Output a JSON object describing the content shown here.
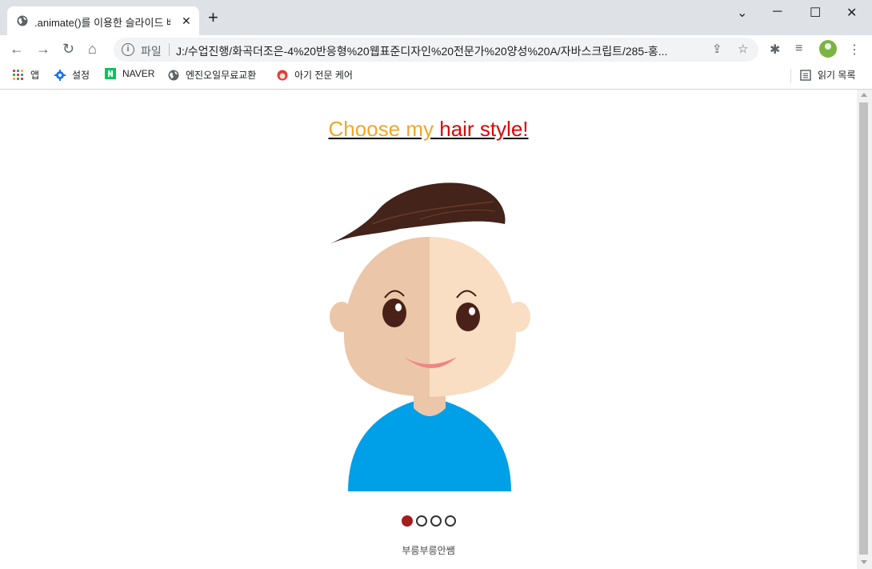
{
  "browser": {
    "tab_title": ".animate()를 이용한 슬라이드 배",
    "url_scheme": "파일",
    "url": "J:/수업진행/화곡더조은-4%20반응형%20웹표준디자인%20전문가%20양성%20A/자바스크립트/285-홍...",
    "bookmarks": [
      {
        "label": "앱",
        "icon": "apps-grid-icon"
      },
      {
        "label": "설정",
        "icon": "gear-icon"
      },
      {
        "label": "NAVER",
        "icon": "naver-icon"
      },
      {
        "label": "엔진오일무료교환",
        "icon": "globe-icon"
      },
      {
        "label": "아기 전문 케어",
        "icon": "baby-care-icon"
      }
    ],
    "reading_list_label": "읽기 목록"
  },
  "page": {
    "heading_part1": "Choose my ",
    "heading_part2": "hair style!",
    "slider": {
      "total": 4,
      "active_index": 0
    },
    "credit": "부릉부릉안쌤"
  },
  "colors": {
    "heading_orange": "#f5a623",
    "heading_red": "#e10000",
    "active_dot": "#a51d1d",
    "shirt": "#00a0e8",
    "hair": "#43231a",
    "skin_light": "#f9dec3",
    "skin_shade": "#ecc6a8"
  }
}
